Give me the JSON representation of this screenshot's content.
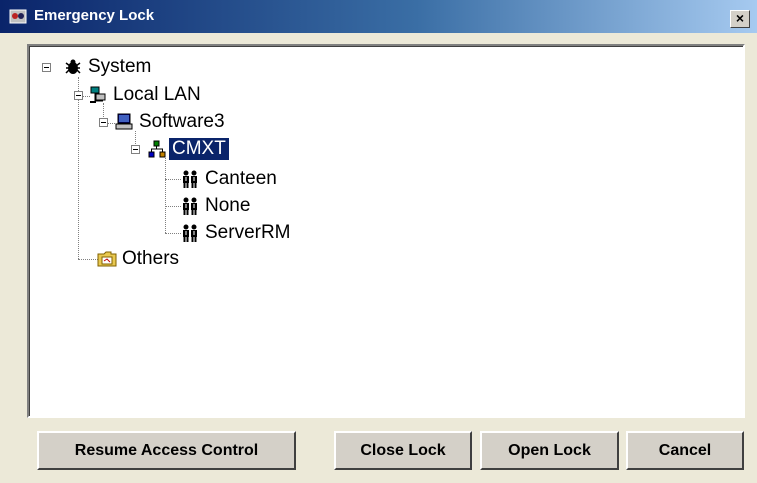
{
  "window": {
    "title": "Emergency Lock",
    "close_label": "×"
  },
  "tree": {
    "system": "System",
    "local_lan": "Local LAN",
    "software3": "Software3",
    "cmxt": "CMXT",
    "canteen": "Canteen",
    "none": "None",
    "serverrm": "ServerRM",
    "others": "Others"
  },
  "buttons": {
    "resume": "Resume Access Control",
    "close_lock": "Close Lock",
    "open_lock": "Open Lock",
    "cancel": "Cancel"
  },
  "colors": {
    "selection": "#0a246a",
    "title_start": "#0a246a",
    "title_end": "#a6caf0"
  }
}
